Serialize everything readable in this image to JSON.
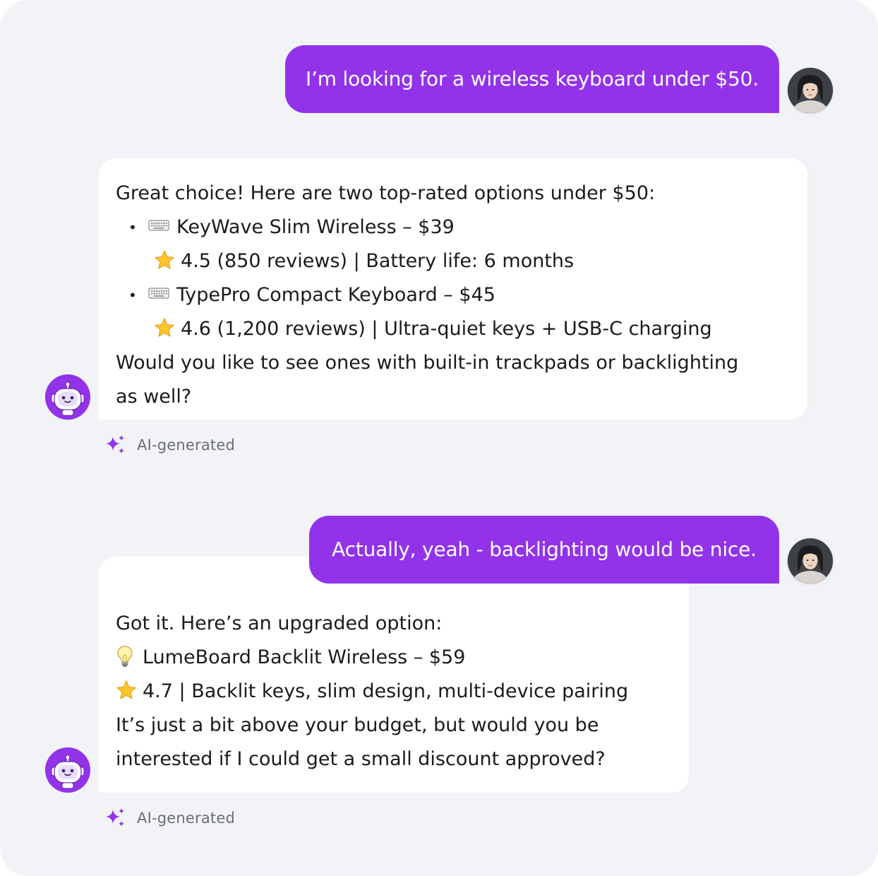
{
  "colors": {
    "accent": "#9233ea",
    "background": "#f2f3f6",
    "bot_bubble": "#ffffff",
    "muted_text": "#6b6e76"
  },
  "messages": [
    {
      "role": "user",
      "text": "I’m looking for a wireless keyboard under $50.",
      "avatar": "user-avatar"
    },
    {
      "role": "assistant",
      "intro": "Great choice! Here are two top-rated options under $50:",
      "items": [
        {
          "icon": "keyboard-icon",
          "title": "KeyWave Slim Wireless – $39",
          "detail_icon": "star-icon",
          "detail": "4.5 (850 reviews) | Battery life: 6 months"
        },
        {
          "icon": "keyboard-icon",
          "title": "TypePro Compact Keyboard – $45",
          "detail_icon": "star-icon",
          "detail": "4.6 (1,200 reviews) | Ultra-quiet keys + USB-C charging"
        }
      ],
      "outro_line1": "Would you like to see ones with built-in trackpads or backlighting",
      "outro_line2": "as well?",
      "tag": "AI-generated",
      "avatar": "robot-avatar"
    },
    {
      "role": "user",
      "text": "Actually, yeah - backlighting would be nice.",
      "avatar": "user-avatar"
    },
    {
      "role": "assistant",
      "intro": "Got it. Here’s an upgraded option:",
      "product_icon": "lightbulb-icon",
      "product": "LumeBoard Backlit Wireless – $59",
      "detail_icon": "star-icon",
      "detail": "4.7 | Backlit keys, slim design, multi-device pairing",
      "outro_line1": "It’s just a bit above your budget, but would you be",
      "outro_line2": "interested if I could get a small discount approved?",
      "tag": "AI-generated",
      "avatar": "robot-avatar"
    }
  ]
}
